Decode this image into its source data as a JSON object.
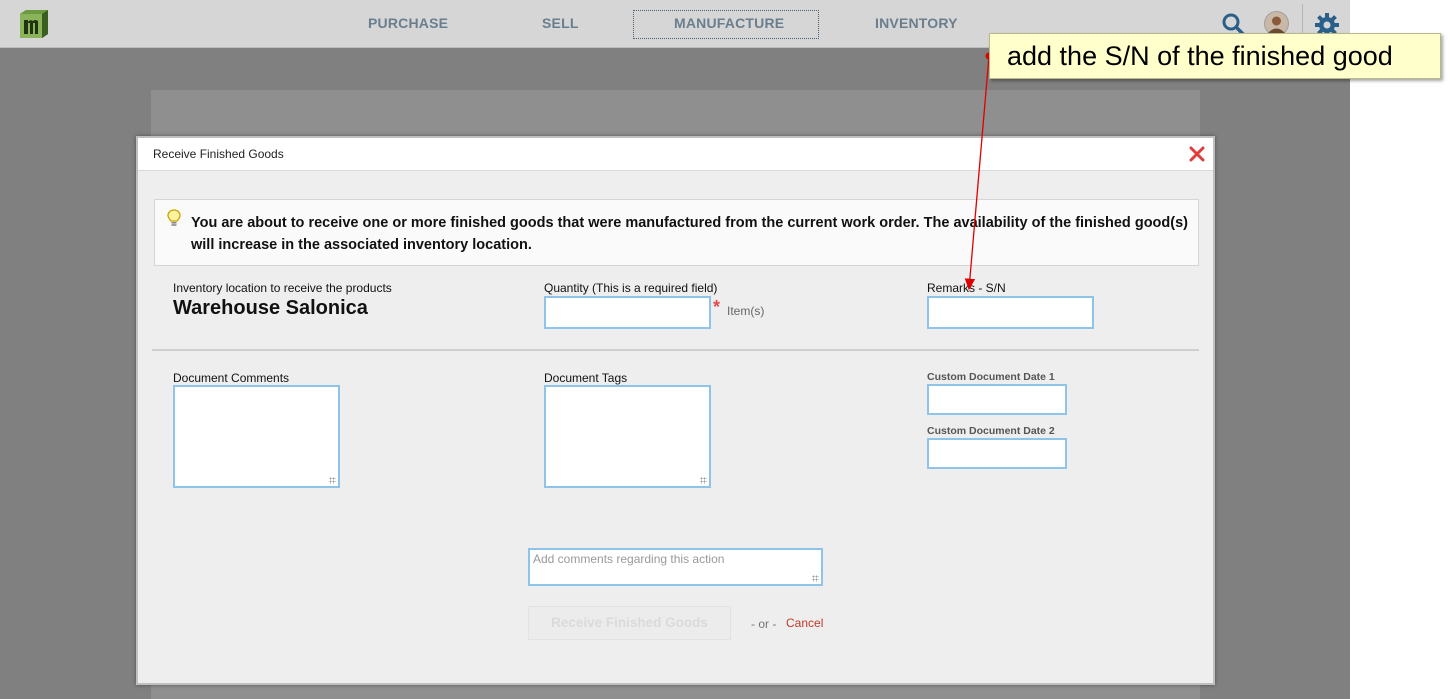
{
  "nav": {
    "items": [
      "PURCHASE",
      "SELL",
      "MANUFACTURE",
      "INVENTORY"
    ],
    "active": "MANUFACTURE"
  },
  "modal": {
    "title": "Receive Finished Goods",
    "info": "You are about to receive one or more finished goods that were manufactured from the current work order. The availability of the finished good(s) will increase in the associated inventory location.",
    "inventory_location_label": "Inventory location to receive the products",
    "inventory_location_value": "Warehouse Salonica",
    "quantity_label": "Quantity (This is a required field)",
    "quantity_unit": "Item(s)",
    "quantity_value": "",
    "remarks_label": "Remarks - S/N",
    "remarks_value": "",
    "document_comments_label": "Document Comments",
    "document_tags_label": "Document Tags",
    "custom_date_1_label": "Custom Document Date 1",
    "custom_date_2_label": "Custom Document Date 2",
    "action_comments_placeholder": "Add comments regarding this action",
    "submit_label": "Receive Finished Goods",
    "or_text": "- or -",
    "cancel_label": "Cancel"
  },
  "callout": {
    "text": "add the S/N of the finished good"
  },
  "icons": {
    "logo": "logo-icon",
    "search": "search-icon",
    "avatar": "avatar",
    "settings": "gear-icon",
    "close": "close-icon",
    "tip": "lightbulb-icon"
  },
  "colors": {
    "field_border": "#8ec4ea",
    "close": "#e03c3c",
    "cancel": "#c0392b",
    "callout_bg": "#ffffcc",
    "arrow": "#e00000"
  }
}
